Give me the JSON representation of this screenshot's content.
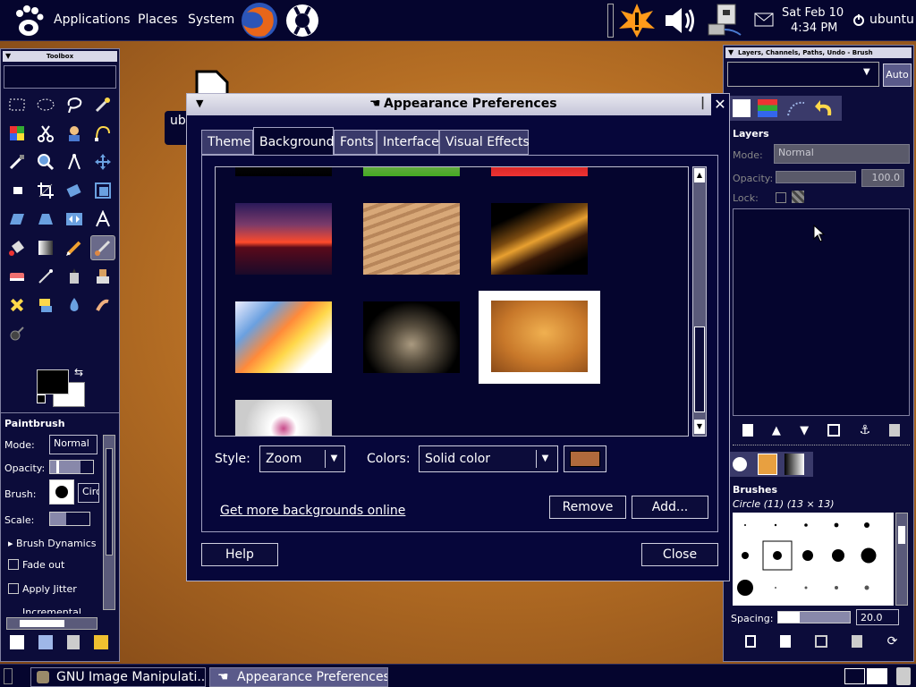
{
  "top_panel": {
    "menus": [
      "Applications",
      "Places",
      "System"
    ],
    "clock_date": "Sat Feb 10",
    "clock_time": "4:34 PM",
    "user": "ubuntu"
  },
  "toolbox": {
    "title": "Toolbox",
    "paintbrush_title": "Paintbrush",
    "mode_label": "Mode:",
    "mode_value": "Normal",
    "opacity_label": "Opacity:",
    "brush_label": "Brush:",
    "brush_value": "Circ",
    "scale_label": "Scale:",
    "brush_dynamics": "Brush Dynamics",
    "fade_out": "Fade out",
    "apply_jitter": "Apply Jitter",
    "incremental": "Incremental"
  },
  "desktop": {
    "icon_label_fragment": "ub"
  },
  "layers_dock": {
    "title": "Layers, Channels, Paths, Undo - Brush",
    "auto_button": "Auto",
    "layers_label": "Layers",
    "mode_label": "Mode:",
    "mode_value": "Normal",
    "opacity_label": "Opacity:",
    "opacity_value": "100.0",
    "lock_label": "Lock:",
    "brushes_label": "Brushes",
    "brush_name": "Circle (11) (13 × 13)",
    "spacing_label": "Spacing:",
    "spacing_value": "20.0"
  },
  "dialog": {
    "title": "Appearance Preferences",
    "tabs": [
      "Theme",
      "Background",
      "Fonts",
      "Interface",
      "Visual Effects"
    ],
    "active_tab": "Background",
    "style_label": "Style:",
    "style_value": "Zoom",
    "colors_label": "Colors:",
    "colors_value": "Solid color",
    "color_swatch": "#b06a3c",
    "link": "Get more backgrounds online",
    "remove_button": "Remove",
    "add_button": "Add...",
    "help_button": "Help",
    "close_button": "Close"
  },
  "taskbar": {
    "tasks": [
      "GNU Image Manipulati...",
      "Appearance Preferences"
    ]
  },
  "colors": {
    "panel_bg": "#05052e",
    "dialog_bg": "#06063a",
    "accent": "#b06a3c"
  }
}
